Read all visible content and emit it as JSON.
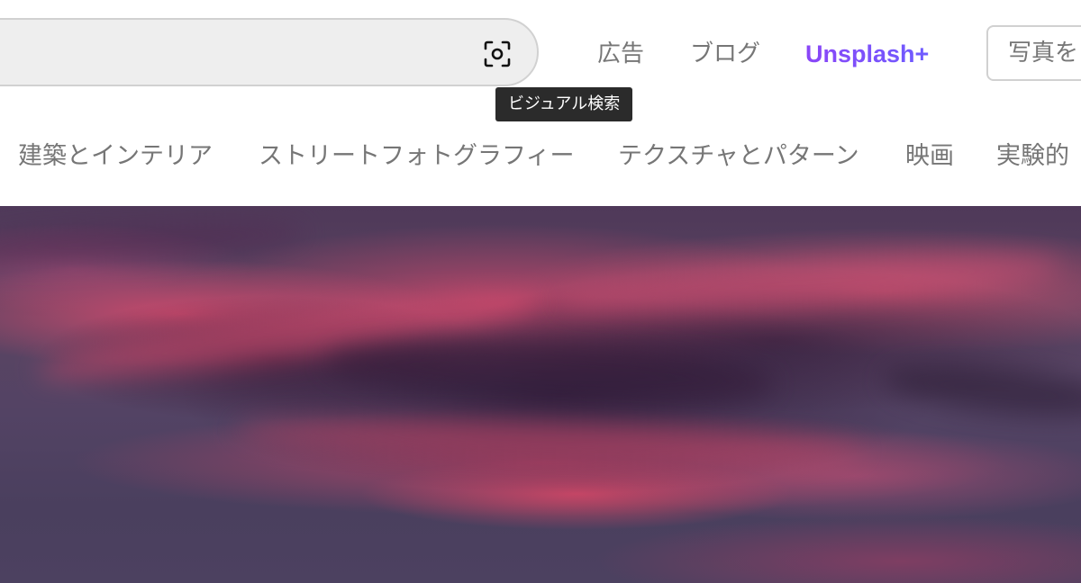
{
  "header": {
    "visual_search_tooltip": "ビジュアル検索",
    "nav": {
      "ad": "広告",
      "blog": "ブログ",
      "unsplash_plus": "Unsplash+"
    },
    "submit_photo_label": "写真を"
  },
  "topics": [
    {
      "label": "建築とインテリア"
    },
    {
      "label": "ストリートフォトグラフィー"
    },
    {
      "label": "テクスチャとパターン"
    },
    {
      "label": "映画"
    },
    {
      "label": "実験的"
    }
  ],
  "icons": {
    "visual_search": "visual-search-icon"
  },
  "colors": {
    "unsplash_plus": "#7b4dff",
    "nav_text": "#767676",
    "tooltip_bg": "#2b2b2b",
    "search_bg": "#eeeeee"
  }
}
